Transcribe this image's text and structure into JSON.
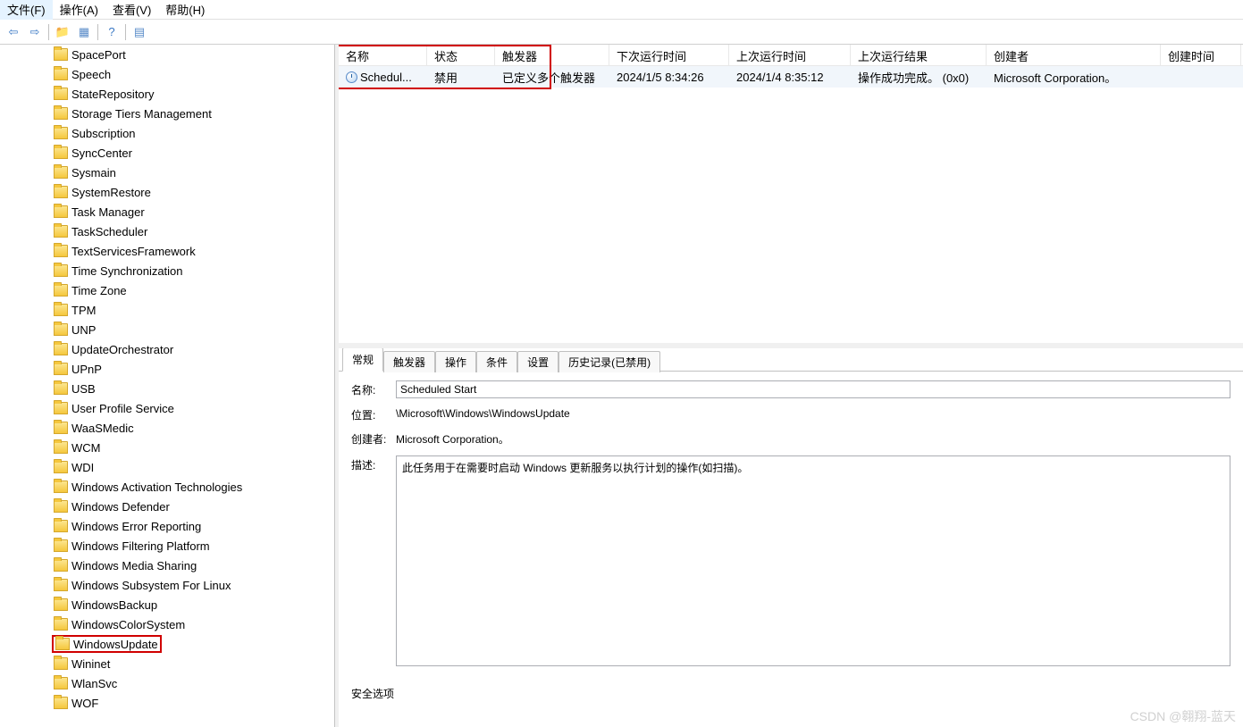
{
  "menubar": {
    "file": "文件(F)",
    "action": "操作(A)",
    "view": "查看(V)",
    "help": "帮助(H)"
  },
  "tree": {
    "items": [
      "SpacePort",
      "Speech",
      "StateRepository",
      "Storage Tiers Management",
      "Subscription",
      "SyncCenter",
      "Sysmain",
      "SystemRestore",
      "Task Manager",
      "TaskScheduler",
      "TextServicesFramework",
      "Time Synchronization",
      "Time Zone",
      "TPM",
      "UNP",
      "UpdateOrchestrator",
      "UPnP",
      "USB",
      "User Profile Service",
      "WaaSMedic",
      "WCM",
      "WDI",
      "Windows Activation Technologies",
      "Windows Defender",
      "Windows Error Reporting",
      "Windows Filtering Platform",
      "Windows Media Sharing",
      "Windows Subsystem For Linux",
      "WindowsBackup",
      "WindowsColorSystem",
      "WindowsUpdate",
      "Wininet",
      "WlanSvc",
      "WOF"
    ],
    "selected": "WindowsUpdate"
  },
  "taskList": {
    "columns": {
      "name": "名称",
      "status": "状态",
      "triggers": "触发器",
      "nextRun": "下次运行时间",
      "lastRun": "上次运行时间",
      "lastResult": "上次运行结果",
      "author": "创建者",
      "created": "创建时间"
    },
    "row": {
      "name": "Schedul...",
      "status": "禁用",
      "triggers": "已定义多个触发器",
      "nextRun": "2024/1/5 8:34:26",
      "lastRun": "2024/1/4 8:35:12",
      "lastResult": "操作成功完成。 (0x0)",
      "author": "Microsoft Corporation。"
    }
  },
  "tabs": {
    "general": "常规",
    "triggers": "触发器",
    "actions": "操作",
    "conditions": "条件",
    "settings": "设置",
    "history": "历史记录(已禁用)"
  },
  "detail": {
    "nameLabel": "名称:",
    "nameValue": "Scheduled Start",
    "locationLabel": "位置:",
    "locationValue": "\\Microsoft\\Windows\\WindowsUpdate",
    "authorLabel": "创建者:",
    "authorValue": "Microsoft Corporation。",
    "descLabel": "描述:",
    "descValue": "此任务用于在需要时启动 Windows 更新服务以执行计划的操作(如扫描)。",
    "securityLabel": "安全选项"
  },
  "watermark": "CSDN @翱翔-蓝天"
}
